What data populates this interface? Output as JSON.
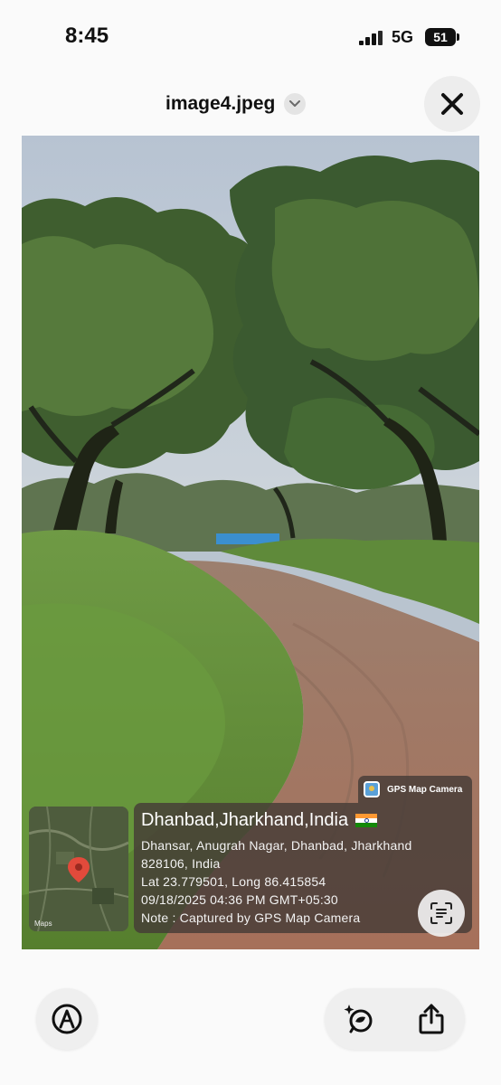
{
  "status_bar": {
    "time": "8:45",
    "network": "5G",
    "battery": "51"
  },
  "header": {
    "filename": "image4.jpeg",
    "chevron_icon": "chevron-down-icon",
    "close_icon": "close-icon"
  },
  "photo": {
    "description_icon": "photo"
  },
  "gps_overlay": {
    "badge_label": "GPS Map Camera",
    "title": "Dhanbad,Jharkhand,India",
    "address_line_1": "Dhansar, Anugrah Nagar, Dhanbad, Jharkhand",
    "address_line_2": "828106, India",
    "coordinates": "Lat 23.779501, Long 86.415854",
    "datetime": "09/18/2025 04:36 PM GMT+05:30",
    "note": "Note : Captured by GPS Map Camera",
    "map_attribution": "Maps",
    "flag_colors": [
      "#ff9933",
      "#ffffff",
      "#138808"
    ]
  },
  "toolbar": {
    "markup_icon": "markup-icon",
    "visual_lookup_icon": "visual-lookup-icon",
    "share_icon": "share-icon",
    "scan_icon": "live-text-icon"
  }
}
